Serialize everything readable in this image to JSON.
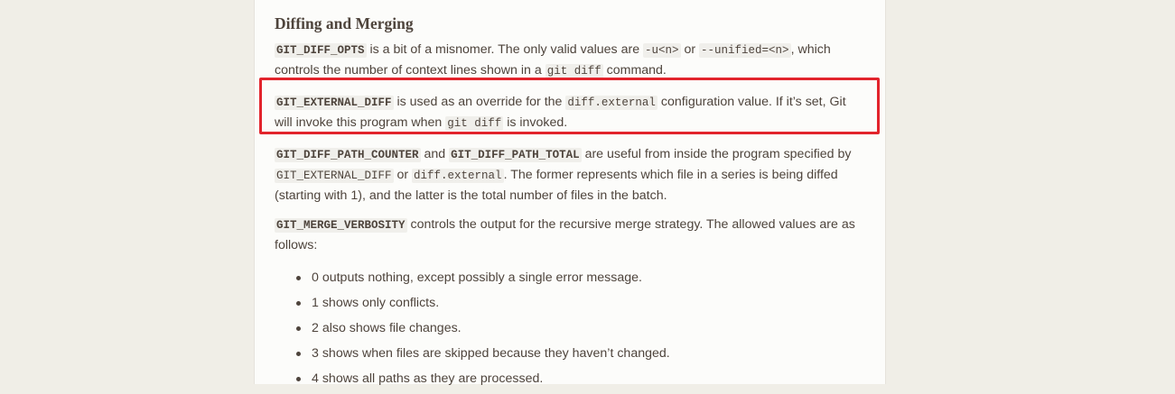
{
  "section": {
    "heading": "Diffing and Merging"
  },
  "para1": {
    "code1": "GIT_DIFF_OPTS",
    "text1": " is a bit of a misnomer. The only valid values are ",
    "code2": "-u<n>",
    "text2": " or ",
    "code3": "--unified=<n>",
    "text3": ", which controls the number of context lines shown in a ",
    "code4": "git diff",
    "text4": " command."
  },
  "para2": {
    "code1": "GIT_EXTERNAL_DIFF",
    "text1": " is used as an override for the ",
    "code2": "diff.external",
    "text2": " configuration value. If it’s set, Git will invoke this program when ",
    "code3": "git diff",
    "text3": " is invoked."
  },
  "para3": {
    "code1": "GIT_DIFF_PATH_COUNTER",
    "text1": " and ",
    "code2": "GIT_DIFF_PATH_TOTAL",
    "text2": " are useful from inside the program specified by ",
    "code3": "GIT_EXTERNAL_DIFF",
    "text3": " or ",
    "code4": "diff.external",
    "text4": ". The former represents which file in a series is being diffed (starting with 1), and the latter is the total number of files in the batch."
  },
  "para4": {
    "code1": "GIT_MERGE_VERBOSITY",
    "text1": " controls the output for the recursive merge strategy. The allowed values are as follows:"
  },
  "list": [
    "0 outputs nothing, except possibly a single error message.",
    "1 shows only conflicts.",
    "2 also shows file changes.",
    "3 shows when files are skipped because they haven’t changed.",
    "4 shows all paths as they are processed."
  ],
  "colors": {
    "page_background": "#f0eee7",
    "panel_background": "#fcfcfa",
    "text": "#4e443c",
    "highlight_border": "#e2242c"
  }
}
